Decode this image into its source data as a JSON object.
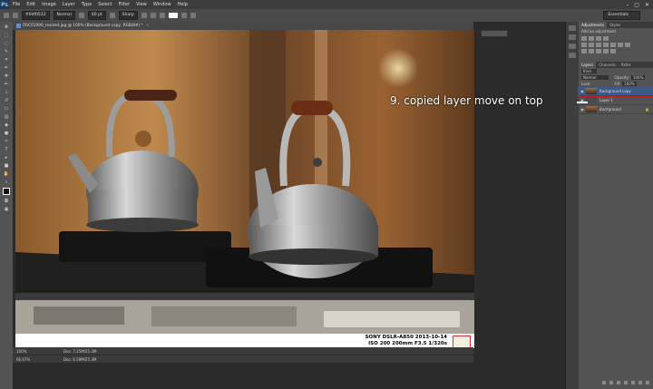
{
  "menubar": {
    "logo": "Ps",
    "items": [
      "File",
      "Edit",
      "Image",
      "Layer",
      "Type",
      "Select",
      "Filter",
      "View",
      "Window",
      "Help"
    ],
    "window_controls": [
      "–",
      "▢",
      "✕"
    ]
  },
  "options": {
    "color_field": "#0df0522",
    "mode": "Normal",
    "size": "60 pt",
    "antialias": "Sharp",
    "workspace": "Essentials"
  },
  "document": {
    "tab_title": "DSC01090_resized.jpg @ 100% (Background copy, RGB/8#) *",
    "close": "×",
    "status_zoom": "100%",
    "status_doc": "Doc: 7.25M/25.3M",
    "status2_zoom": "66.67%",
    "status2_doc": "Doc: 6.59M/25.3M"
  },
  "photo": {
    "caption_line1": "SONY DSLR-A850 2013-10-14",
    "caption_line2": "ISO 200 200mm F3.5 1/320s"
  },
  "adjustments": {
    "tabs": [
      "Adjustments",
      "Styles"
    ],
    "add_label": "Add an adjustment"
  },
  "layers_panel": {
    "tabs": [
      "Layers",
      "Channels",
      "Paths"
    ],
    "kind": "Kind",
    "blend": "Normal",
    "opacity_label": "Opacity:",
    "opacity_value": "100%",
    "lock_label": "Lock:",
    "fill_label": "Fill:",
    "fill_value": "100%",
    "layers": [
      {
        "name": "Background copy",
        "selected": true
      },
      {
        "name": "Layer 1",
        "selected": false
      },
      {
        "name": "Background",
        "selected": false
      }
    ]
  },
  "annotation": "9. copied layer move on top",
  "colors": {
    "accent": "#c0202a",
    "selection": "#3c5a85"
  }
}
